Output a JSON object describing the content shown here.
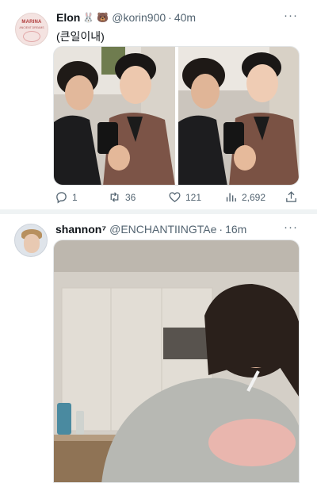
{
  "tweets": [
    {
      "display_name": "Elon",
      "emojis": [
        "🐰",
        "🐻"
      ],
      "handle": "@korin900",
      "separator": "·",
      "time": "40m",
      "text": "(큰일이내)",
      "avatar_icon": "album-cover-icon",
      "actions": {
        "reply": "1",
        "retweet": "36",
        "like": "121",
        "views": "2,692"
      }
    },
    {
      "display_name": "shannon⁷",
      "handle": "@ENCHANTIINGTAe",
      "separator": "·",
      "time": "16m",
      "avatar_icon": "profile-photo-icon"
    }
  ],
  "more_label": "···",
  "avatar1_text": {
    "brand": "MARINA",
    "sub": "ANCIENT DREAMS"
  },
  "colors": {
    "text_primary": "#0f1419",
    "text_secondary": "#536471",
    "separator": "#eff3f4"
  }
}
